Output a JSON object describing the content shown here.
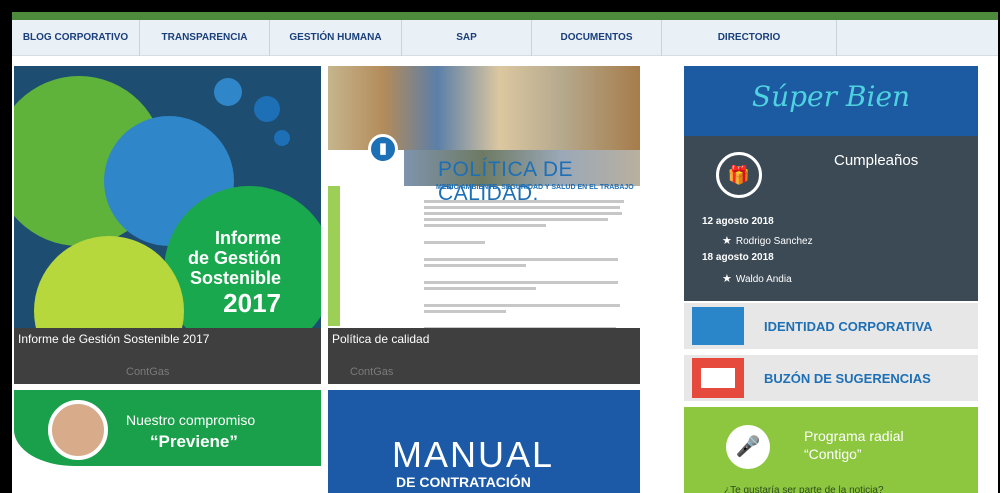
{
  "nav": {
    "items": [
      "BLOG CORPORATIVO",
      "TRANSPARENCIA",
      "GESTIÓN HUMANA",
      "SAP",
      "DOCUMENTOS",
      "DIRECTORIO"
    ]
  },
  "informe": {
    "image_line1": "Informe",
    "image_line2": "de Gestión",
    "image_line3": "Sostenible",
    "image_year": "2017",
    "caption": "Informe de Gestión Sostenible 2017",
    "logo": "ContGas"
  },
  "politica": {
    "title": "POLÍTICA DE CALIDAD,",
    "subtitle": "MEDIO AMBIENTE, SEGURIDAD Y SALUD EN EL TRABAJO",
    "caption": "Política de calidad",
    "logo": "ContGas"
  },
  "superbien": {
    "label": "Súper Bien"
  },
  "cumpleanos": {
    "title": "Cumpleaños",
    "entries": [
      {
        "date": "12 agosto 2018",
        "name": "Rodrigo Sanchez"
      },
      {
        "date": "18 agosto 2018",
        "name": "Waldo Andia"
      }
    ]
  },
  "identidad": {
    "label": "IDENTIDAD CORPORATIVA"
  },
  "buzon": {
    "label": "BUZÓN DE SUGERENCIAS"
  },
  "radio": {
    "line1": "Programa radial",
    "line2": "“Contigo”",
    "cut_text": "¿Te gustaría ser parte de la noticia?"
  },
  "compromiso": {
    "line1": "Nuestro compromiso",
    "line2": "“Previene”"
  },
  "manual": {
    "line1": "MANUAL",
    "line2": "DE CONTRATACIÓN"
  },
  "colors": {
    "nav_bg": "#e9f0f6",
    "nav_text": "#1a3f7a",
    "top_strip": "#4e8a3c",
    "caption_bg": "#3f3f3f",
    "superbien_bg": "#1c5aa2",
    "cumple_bg": "#3c4a56",
    "radio_bg": "#8dc63f",
    "manual_bg": "#1c59a6",
    "compromiso_green": "#1aa04a"
  },
  "icons": [
    "gift-icon",
    "star-icon",
    "people-icon",
    "envelope-icon",
    "microphone-icon",
    "document-icon",
    "heart-icon"
  ]
}
